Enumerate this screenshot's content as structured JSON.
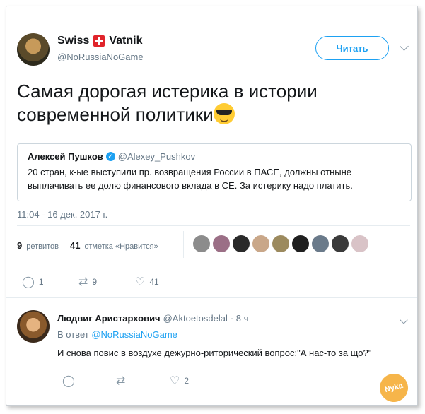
{
  "tweet": {
    "author_name_part1": "Swiss",
    "author_name_part2": "Vatnik",
    "author_handle": "@NoRussiaNoGame",
    "follow_label": "Читать",
    "text": "Самая дорогая истерика в истории современной политики",
    "quote": {
      "name": "Алексей Пушков",
      "handle": "@Alexey_Pushkov",
      "text": "20 стран, к-ые выступили пр. возвращения России в ПАСЕ, должны отныне выплачивать ее долю финансового вклада в СЕ. За истерику надо платить."
    },
    "timestamp": "11:04 - 16 дек. 2017 г.",
    "retweets_count": "9",
    "retweets_label": "ретвитов",
    "likes_count": "41",
    "likes_label": "отметка «Нравится»",
    "actions": {
      "reply_count": "1",
      "retweet_count": "9",
      "like_count": "41"
    },
    "liker_colors": [
      "#8c8c8c",
      "#9b6f86",
      "#2a2a2a",
      "#c9a789",
      "#9c8a5e",
      "#1f1f1f",
      "#6a7a8a",
      "#3a3a3a",
      "#d9c3c7"
    ]
  },
  "reply": {
    "name": "Людвиг Аристархович",
    "handle": "@Aktoetosdelal",
    "time": "· 8 ч",
    "reply_to_label": "В ответ",
    "reply_to_handle": "@NoRussiaNoGame",
    "text": "И снова повис в воздухе дежурно-риторический вопрос:\"А нас-то за що?\"",
    "reply_count": "",
    "retweet_count": "",
    "like_count": "2"
  },
  "watermark": "Nyka"
}
